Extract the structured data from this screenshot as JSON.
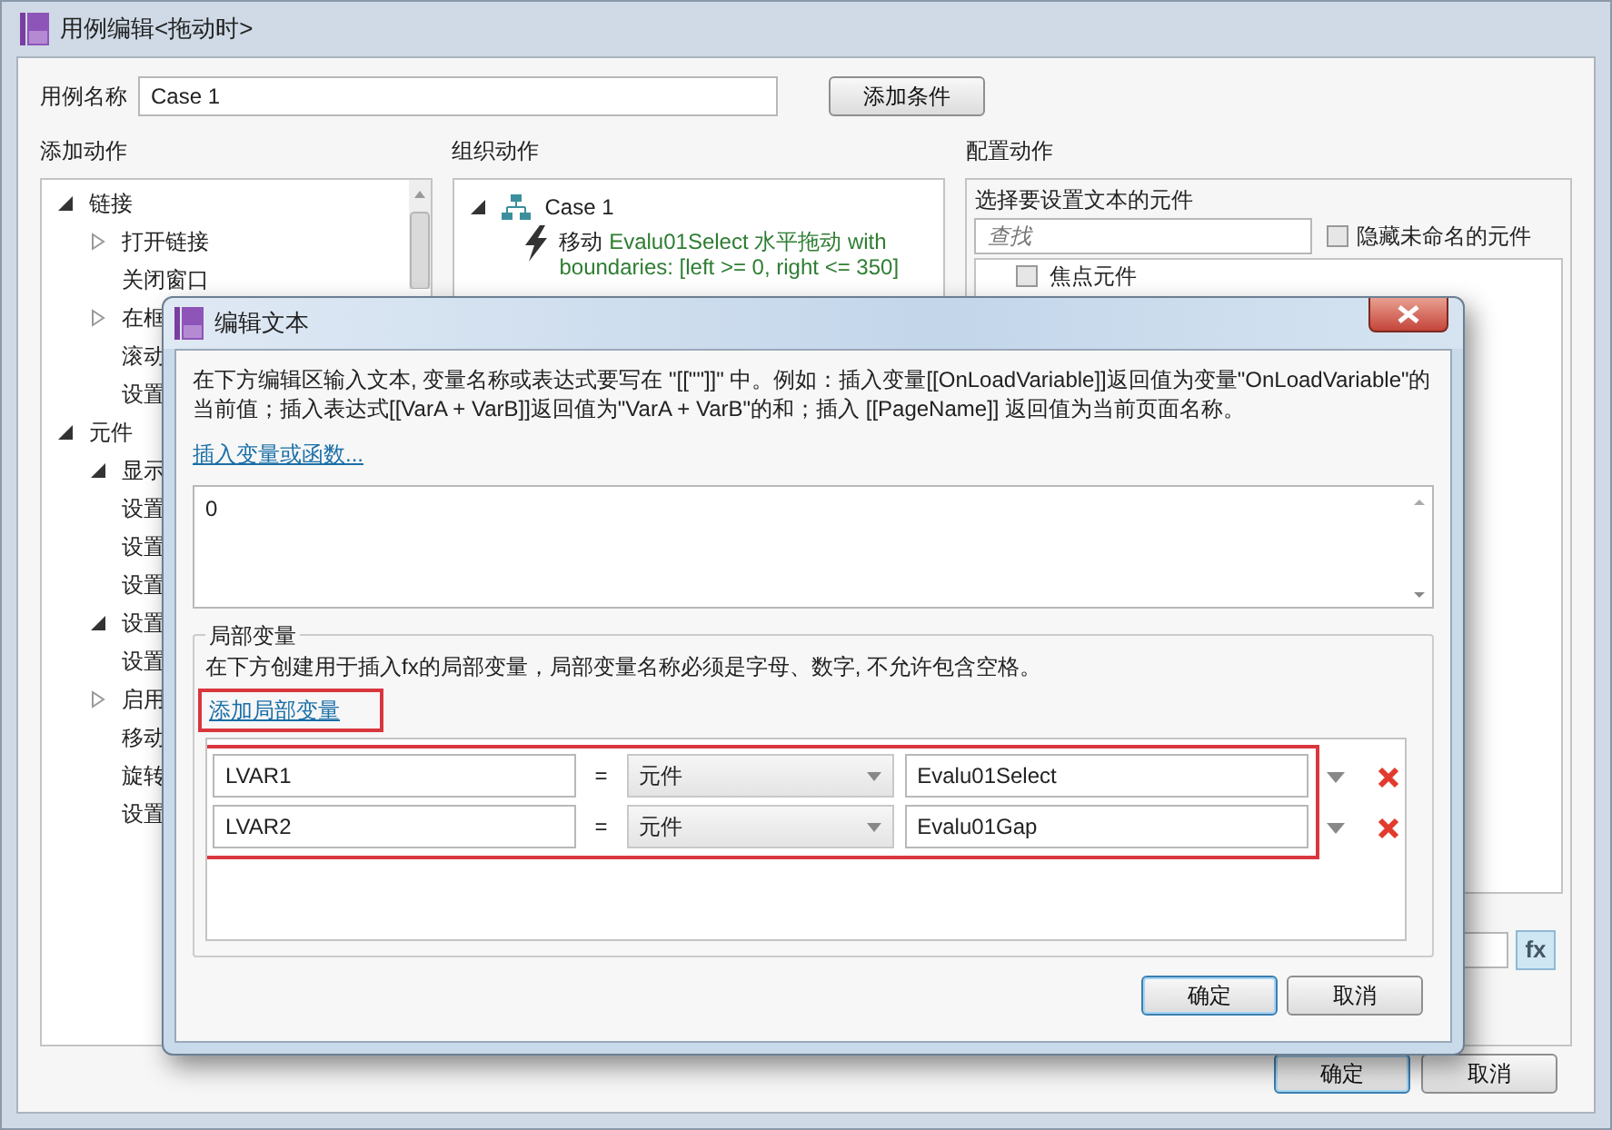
{
  "window": {
    "title": "用例编辑<拖动时>"
  },
  "case_name": {
    "label": "用例名称",
    "value": "Case 1"
  },
  "add_condition_button": "添加条件",
  "add_actions": {
    "heading": "添加动作",
    "tree": [
      {
        "label": "链接",
        "expanded": true,
        "children": [
          {
            "label": "打开链接",
            "expanded": false
          },
          {
            "label": "关闭窗口"
          },
          {
            "label": "在框",
            "expanded": false
          },
          {
            "label": "滚动"
          },
          {
            "label": "设置"
          }
        ]
      },
      {
        "label": "元件",
        "expanded": true,
        "children": [
          {
            "label": "显示",
            "expanded": true
          },
          {
            "label": "设置"
          },
          {
            "label": "设置"
          },
          {
            "label": "设置"
          },
          {
            "label": "设置",
            "expanded": true
          },
          {
            "label": "设置"
          },
          {
            "label": "启用",
            "expanded": false
          },
          {
            "label": "移动"
          },
          {
            "label": "旋转"
          },
          {
            "label": "设置"
          }
        ]
      }
    ]
  },
  "organize_actions": {
    "heading": "组织动作",
    "cases": [
      {
        "label": "Case 1",
        "expanded": true,
        "actions": [
          {
            "verb": "移动",
            "detail": "Evalu01Select 水平拖动 with boundaries: [left >= 0, right <= 350]"
          }
        ]
      }
    ]
  },
  "configure_actions": {
    "heading": "配置动作",
    "prompt": "选择要设置文本的元件",
    "search": {
      "placeholder": "查找"
    },
    "hide_unnamed": {
      "label": "隐藏未命名的元件",
      "checked": false
    },
    "widgets": [
      {
        "label": "焦点元件",
        "checked": false
      }
    ],
    "fx_button": "fx"
  },
  "buttons": [
    {
      "label": "确定",
      "default": true
    },
    {
      "label": "取消",
      "default": false
    }
  ],
  "dialog": {
    "title": "编辑文本",
    "intro": "在下方编辑区输入文本, 变量名称或表达式要写在 \"[[\"\"]]\" 中。例如：插入变量[[OnLoadVariable]]返回值为变量\"OnLoadVariable\"的当前值；插入表达式[[VarA + VarB]]返回值为\"VarA + VarB\"的和；插入 [[PageName]] 返回值为当前页面名称。",
    "insert_link": "插入变量或函数...",
    "text_value": "0",
    "local_vars": {
      "heading": "局部变量",
      "hint": "在下方创建用于插入fx的局部变量，局部变量名称必须是字母、数字, 不允许包含空格。",
      "add_link": "添加局部变量",
      "rows": [
        {
          "name": "LVAR1",
          "equals": "=",
          "type": "元件",
          "target": "Evalu01Select"
        },
        {
          "name": "LVAR2",
          "equals": "=",
          "type": "元件",
          "target": "Evalu01Gap"
        }
      ]
    },
    "buttons": [
      {
        "label": "确定",
        "default": true
      },
      {
        "label": "取消",
        "default": false
      }
    ]
  }
}
